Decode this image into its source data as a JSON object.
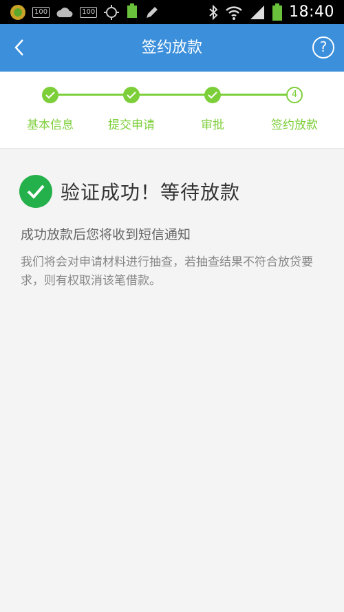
{
  "status_bar": {
    "badge_1": "100",
    "badge_2": "100",
    "battery_small_label": "100%",
    "time": "18:40"
  },
  "header": {
    "title": "签约放款",
    "help_label": "?"
  },
  "stepper": {
    "steps": [
      {
        "label": "基本信息",
        "state": "done"
      },
      {
        "label": "提交申请",
        "state": "done"
      },
      {
        "label": "审批",
        "state": "done"
      },
      {
        "label": "签约放款",
        "state": "current",
        "number": "4"
      }
    ],
    "color": "#7dcf3a"
  },
  "result": {
    "title": "验证成功！等待放款",
    "primary_message": "成功放款后您将收到短信通知",
    "secondary_message": "我们将会对申请材料进行抽查，若抽查结果不符合放贷要求，则有权取消该笔借款。"
  },
  "colors": {
    "app_bar": "#3b8fdb",
    "accent_green": "#7dcf3a",
    "success_green": "#24b04b"
  }
}
